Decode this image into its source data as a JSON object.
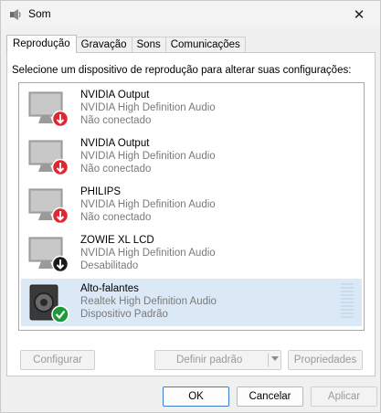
{
  "window": {
    "title": "Som",
    "close_glyph": "✕"
  },
  "tabs": [
    {
      "label": "Reprodução",
      "active": true
    },
    {
      "label": "Gravação",
      "active": false
    },
    {
      "label": "Sons",
      "active": false
    },
    {
      "label": "Comunicações",
      "active": false
    }
  ],
  "instruction": "Selecione um dispositivo de reprodução para alterar suas configurações:",
  "devices": [
    {
      "name": "NVIDIA Output",
      "driver": "NVIDIA High Definition Audio",
      "status": "Não conectado",
      "icon": "monitor-icon",
      "badge": "red-down-arrow"
    },
    {
      "name": "NVIDIA Output",
      "driver": "NVIDIA High Definition Audio",
      "status": "Não conectado",
      "icon": "monitor-icon",
      "badge": "red-down-arrow"
    },
    {
      "name": "PHILIPS",
      "driver": "NVIDIA High Definition Audio",
      "status": "Não conectado",
      "icon": "monitor-icon",
      "badge": "red-down-arrow"
    },
    {
      "name": "ZOWIE XL LCD",
      "driver": "NVIDIA High Definition Audio",
      "status": "Desabilitado",
      "icon": "monitor-icon",
      "badge": "black-down-arrow"
    },
    {
      "name": "Alto-falantes",
      "driver": "Realtek High Definition Audio",
      "status": "Dispositivo Padrão",
      "icon": "speaker-icon",
      "badge": "green-check",
      "selected": true
    }
  ],
  "buttons": {
    "configure": "Configurar",
    "set_default": "Definir padrão",
    "properties": "Propriedades",
    "ok": "OK",
    "cancel": "Cancelar",
    "apply": "Aplicar"
  },
  "colors": {
    "selected_bg": "#dbe9f6",
    "error_badge": "#e0262e",
    "success_badge": "#1f9a3a",
    "primary_border": "#3b7cd1"
  }
}
